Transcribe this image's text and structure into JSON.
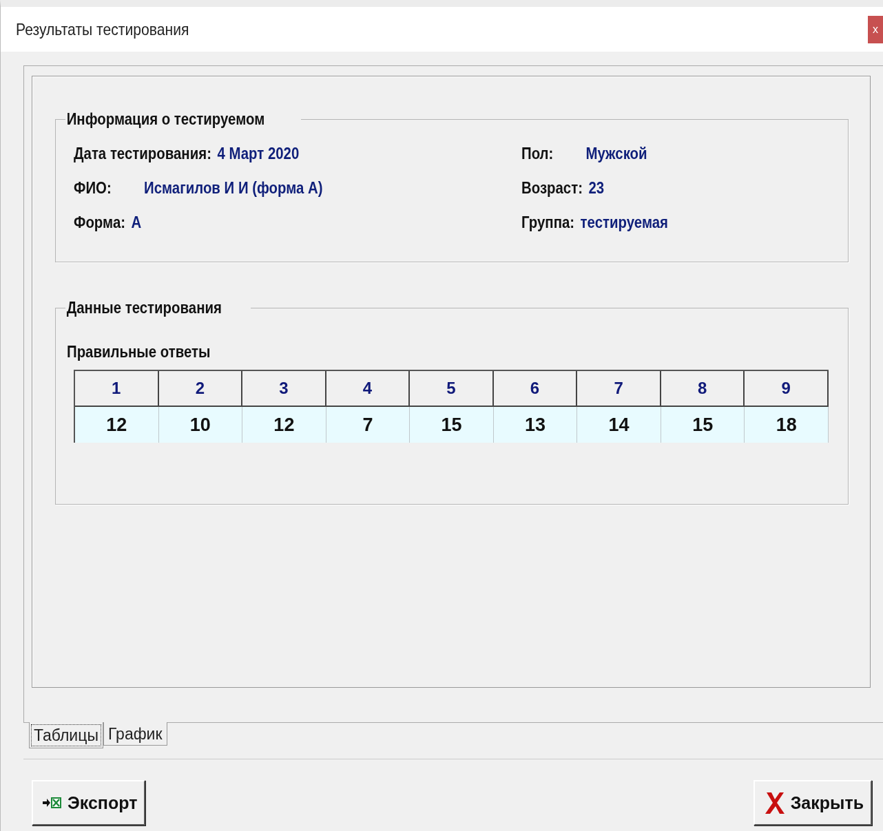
{
  "window": {
    "title": "Результаты тестирования",
    "close": "x"
  },
  "info_group": {
    "title": "Информация о тестируемом",
    "left": [
      {
        "label": "Дата тестирования:",
        "value": "4 Март 2020"
      },
      {
        "label": "ФИО:",
        "value": "Исмагилов И И (форма А)"
      },
      {
        "label": "Форма:",
        "value": "А"
      }
    ],
    "right": [
      {
        "label": "Пол:",
        "value": "Мужской"
      },
      {
        "label": "Возраст:",
        "value": "23"
      },
      {
        "label": "Группа:",
        "value": "тестируемая"
      }
    ]
  },
  "data_group": {
    "title": "Данные тестирования",
    "table_title": "Правильные ответы",
    "table": {
      "columns": [
        "1",
        "2",
        "3",
        "4",
        "5",
        "6",
        "7",
        "8",
        "9"
      ],
      "rows": [
        [
          "12",
          "10",
          "12",
          "7",
          "15",
          "13",
          "14",
          "15",
          "18"
        ]
      ]
    }
  },
  "tabs": [
    {
      "label": "Таблицы",
      "selected": true
    },
    {
      "label": "График",
      "selected": false
    }
  ],
  "buttons": [
    {
      "label": "Экспорт",
      "kind": "export"
    },
    {
      "label": "Закрыть",
      "kind": "close"
    }
  ]
}
